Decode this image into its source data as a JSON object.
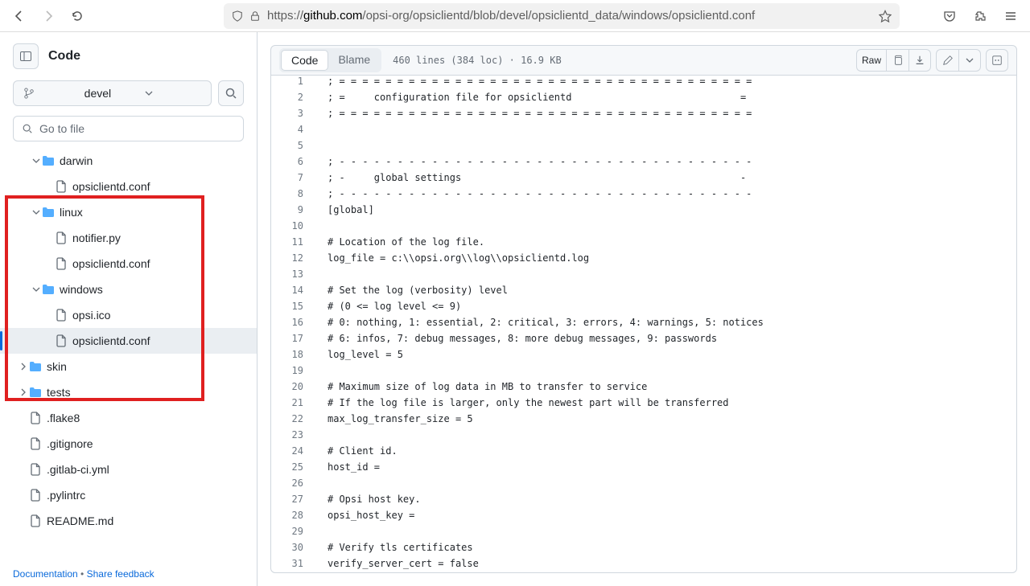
{
  "url": {
    "prefix": "https://",
    "domain": "github.com",
    "path": "/opsi-org/opsiclientd/blob/devel/opsiclientd_data/windows/opsiclientd.conf"
  },
  "sidebar": {
    "title": "Code",
    "branch": "devel",
    "gotoPlaceholder": "Go to file",
    "footer": {
      "doc": "Documentation",
      "sep": " • ",
      "feedback": "Share feedback"
    }
  },
  "tree": [
    {
      "type": "folder",
      "name": "darwin",
      "depth": 2,
      "expanded": true
    },
    {
      "type": "file",
      "name": "opsiclientd.conf",
      "depth": 3
    },
    {
      "type": "folder",
      "name": "linux",
      "depth": 2,
      "expanded": true
    },
    {
      "type": "file",
      "name": "notifier.py",
      "depth": 3
    },
    {
      "type": "file",
      "name": "opsiclientd.conf",
      "depth": 3
    },
    {
      "type": "folder",
      "name": "windows",
      "depth": 2,
      "expanded": true
    },
    {
      "type": "file",
      "name": "opsi.ico",
      "depth": 3
    },
    {
      "type": "file",
      "name": "opsiclientd.conf",
      "depth": 3,
      "selected": true
    },
    {
      "type": "folder",
      "name": "skin",
      "depth": 1,
      "expanded": false
    },
    {
      "type": "folder",
      "name": "tests",
      "depth": 1,
      "expanded": false
    },
    {
      "type": "file",
      "name": ".flake8",
      "depth": 1
    },
    {
      "type": "file",
      "name": ".gitignore",
      "depth": 1
    },
    {
      "type": "file",
      "name": ".gitlab-ci.yml",
      "depth": 1
    },
    {
      "type": "file",
      "name": ".pylintrc",
      "depth": 1
    },
    {
      "type": "file",
      "name": "README.md",
      "depth": 1
    }
  ],
  "toolbar": {
    "code": "Code",
    "blame": "Blame",
    "meta": "460 lines (384 loc) · 16.9 KB",
    "raw": "Raw"
  },
  "code": [
    "; = = = = = = = = = = = = = = = = = = = = = = = = = = = = = = = = = = = =",
    "; =     configuration file for opsiclientd                             =",
    "; = = = = = = = = = = = = = = = = = = = = = = = = = = = = = = = = = = = =",
    "",
    "",
    "; - - - - - - - - - - - - - - - - - - - - - - - - - - - - - - - - - - - -",
    "; -     global settings                                                -",
    "; - - - - - - - - - - - - - - - - - - - - - - - - - - - - - - - - - - - -",
    "[global]",
    "",
    "# Location of the log file.",
    "log_file = c:\\\\opsi.org\\\\log\\\\opsiclientd.log",
    "",
    "# Set the log (verbosity) level",
    "# (0 <= log level <= 9)",
    "# 0: nothing, 1: essential, 2: critical, 3: errors, 4: warnings, 5: notices",
    "# 6: infos, 7: debug messages, 8: more debug messages, 9: passwords",
    "log_level = 5",
    "",
    "# Maximum size of log data in MB to transfer to service",
    "# If the log file is larger, only the newest part will be transferred",
    "max_log_transfer_size = 5",
    "",
    "# Client id.",
    "host_id =",
    "",
    "# Opsi host key.",
    "opsi_host_key =",
    "",
    "# Verify tls certificates",
    "verify_server_cert = false"
  ]
}
